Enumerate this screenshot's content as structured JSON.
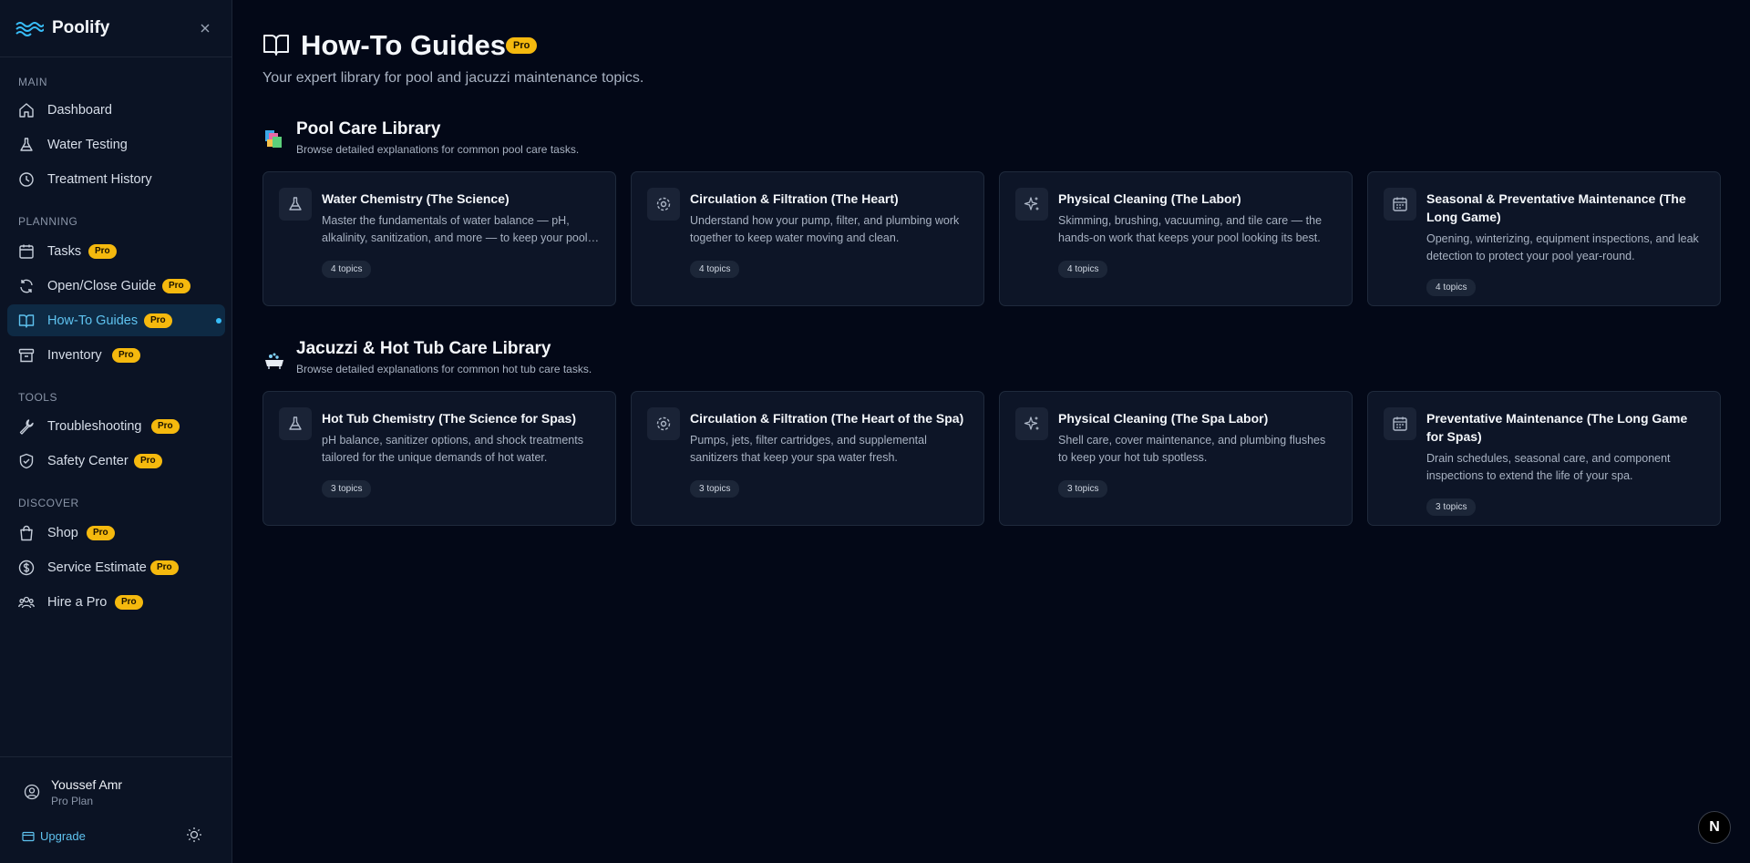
{
  "brand": {
    "name": "Poolify"
  },
  "sidebar": {
    "sections": [
      {
        "label": "MAIN",
        "items": [
          {
            "label": "Dashboard",
            "icon": "home-icon",
            "pro": false
          },
          {
            "label": "Water Testing",
            "icon": "flask-icon",
            "pro": false
          },
          {
            "label": "Treatment History",
            "icon": "clock-icon",
            "pro": false
          }
        ]
      },
      {
        "label": "PLANNING",
        "items": [
          {
            "label": "Tasks",
            "icon": "calendar-icon",
            "pro": true
          },
          {
            "label": "Open/Close Guide",
            "icon": "refresh-icon",
            "pro": true
          },
          {
            "label": "How-To Guides",
            "icon": "book-icon",
            "pro": true,
            "active": true
          },
          {
            "label": "Inventory",
            "icon": "archive-icon",
            "pro": true
          }
        ]
      },
      {
        "label": "TOOLS",
        "items": [
          {
            "label": "Troubleshooting",
            "icon": "wrench-icon",
            "pro": true
          },
          {
            "label": "Safety Center",
            "icon": "shield-icon",
            "pro": true
          }
        ]
      },
      {
        "label": "DISCOVER",
        "items": [
          {
            "label": "Shop",
            "icon": "bag-icon",
            "pro": true
          },
          {
            "label": "Service Estimate",
            "icon": "dollar-icon",
            "pro": true
          },
          {
            "label": "Hire a Pro",
            "icon": "users-icon",
            "pro": true
          }
        ]
      }
    ],
    "pro_label": "Pro"
  },
  "user": {
    "name": "Youssef Amr",
    "plan": "Pro Plan"
  },
  "footer": {
    "upgrade_label": "Upgrade"
  },
  "page": {
    "title": "How-To Guides",
    "badge": "Pro",
    "subtitle": "Your expert library for pool and jacuzzi maintenance topics."
  },
  "libraries": [
    {
      "title": "Pool Care Library",
      "subtitle": "Browse detailed explanations for common pool care tasks.",
      "icon": "pool-tiles-icon",
      "cards": [
        {
          "title": "Water Chemistry (The Science)",
          "desc": "Master the fundamentals of water balance — pH, alkalinity, sanitization, and more — to keep your pool safe and sparkling.",
          "topics": "4 topics",
          "icon": "flask-icon"
        },
        {
          "title": "Circulation & Filtration (The Heart)",
          "desc": "Understand how your pump, filter, and plumbing work together to keep water moving and clean.",
          "topics": "4 topics",
          "icon": "gear-icon"
        },
        {
          "title": "Physical Cleaning (The Labor)",
          "desc": "Skimming, brushing, vacuuming, and tile care — the hands-on work that keeps your pool looking its best.",
          "topics": "4 topics",
          "icon": "sparkles-icon"
        },
        {
          "title": "Seasonal & Preventative Maintenance (The Long Game)",
          "desc": "Opening, winterizing, equipment inspections, and leak detection to protect your pool year-round.",
          "topics": "4 topics",
          "icon": "calendar-icon"
        }
      ]
    },
    {
      "title": "Jacuzzi & Hot Tub Care Library",
      "subtitle": "Browse detailed explanations for common hot tub care tasks.",
      "icon": "bathtub-icon",
      "cards": [
        {
          "title": "Hot Tub Chemistry (The Science for Spas)",
          "desc": "pH balance, sanitizer options, and shock treatments tailored for the unique demands of hot water.",
          "topics": "3 topics",
          "icon": "flask-icon"
        },
        {
          "title": "Circulation & Filtration (The Heart of the Spa)",
          "desc": "Pumps, jets, filter cartridges, and supplemental sanitizers that keep your spa water fresh.",
          "topics": "3 topics",
          "icon": "gear-icon"
        },
        {
          "title": "Physical Cleaning (The Spa Labor)",
          "desc": "Shell care, cover maintenance, and plumbing flushes to keep your hot tub spotless.",
          "topics": "3 topics",
          "icon": "sparkles-icon"
        },
        {
          "title": "Preventative Maintenance (The Long Game for Spas)",
          "desc": "Drain schedules, seasonal care, and component inspections to extend the life of your spa.",
          "topics": "3 topics",
          "icon": "calendar-icon"
        }
      ]
    }
  ],
  "dev_badge": "N",
  "colors": {
    "accent": "#38bdf8",
    "pro": "#f5b90e",
    "background": "#030817",
    "sidebar": "#0b1324",
    "card": "#0d1527"
  }
}
